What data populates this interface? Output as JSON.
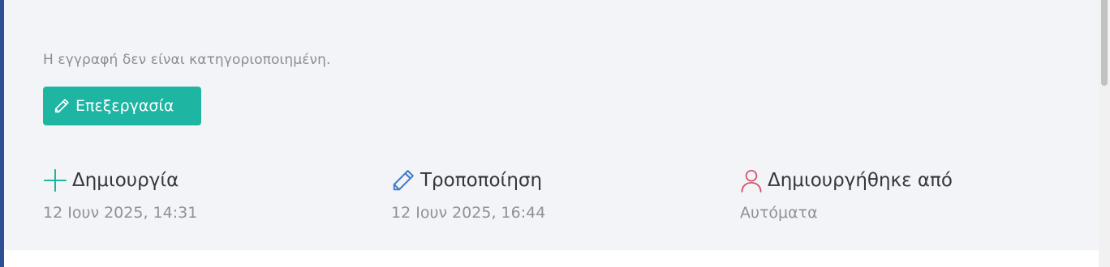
{
  "record": {
    "category_note": "Η εγγραφή δεν είναι κατηγοριοποιημένη.",
    "edit_button_label": "Επεξεργασία",
    "edit_icon": "pencil-icon"
  },
  "meta": {
    "created": {
      "label": "Δημιουργία",
      "value": "12 Ιουν 2025, 14:31",
      "icon": "plus-icon",
      "icon_color": "#1fb5a3"
    },
    "modified": {
      "label": "Τροποποίηση",
      "value": "12 Ιουν 2025, 16:44",
      "icon": "pencil-icon",
      "icon_color": "#3f7ccb"
    },
    "created_by": {
      "label": "Δημιουργήθηκε από",
      "value": "Αυτόματα",
      "icon": "user-icon",
      "icon_color": "#d4536e"
    }
  },
  "colors": {
    "accent": "#1fb5a3",
    "left_border": "#2d4f95",
    "panel_background": "#f3f4f7"
  }
}
